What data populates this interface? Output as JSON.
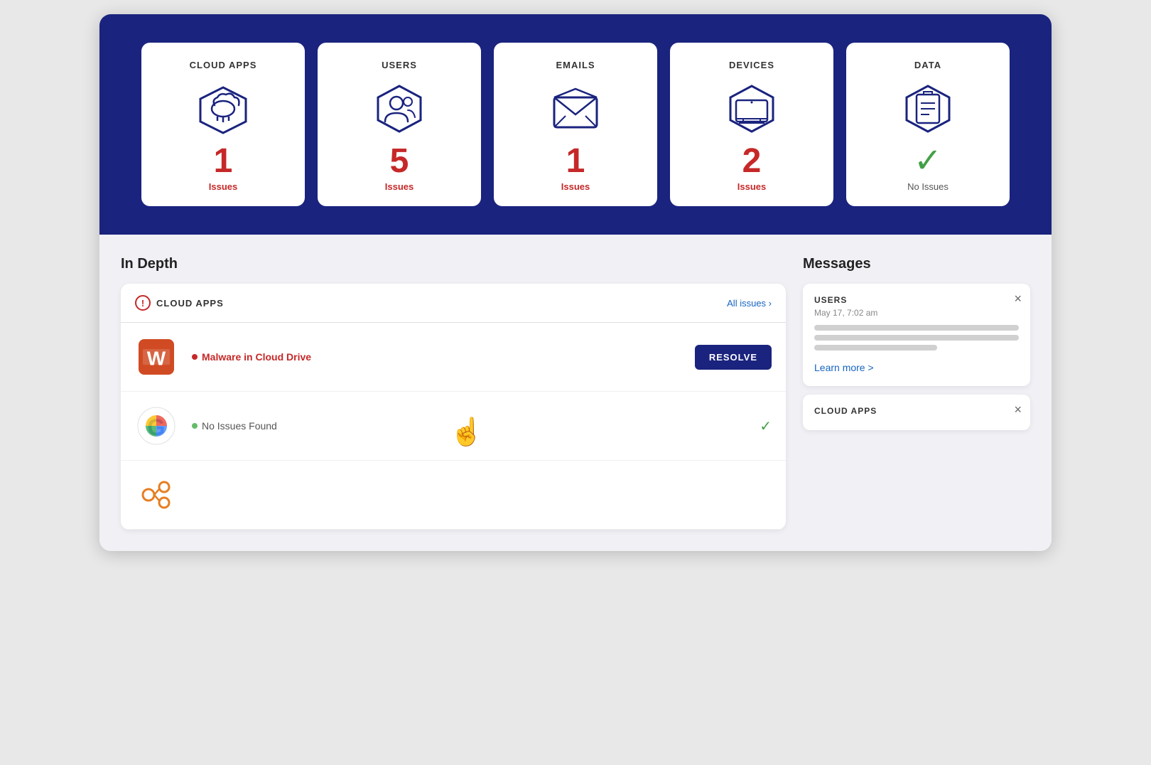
{
  "cards": [
    {
      "id": "cloud-apps",
      "title": "CLOUD APPS",
      "count": "1",
      "label": "Issues",
      "hasIssues": true
    },
    {
      "id": "users",
      "title": "USERS",
      "count": "5",
      "label": "Issues",
      "hasIssues": true
    },
    {
      "id": "emails",
      "title": "EMAILS",
      "count": "1",
      "label": "Issues",
      "hasIssues": true
    },
    {
      "id": "devices",
      "title": "DEVICES",
      "count": "2",
      "label": "Issues",
      "hasIssues": true
    },
    {
      "id": "data",
      "title": "DATA",
      "count": "",
      "label": "No Issues",
      "hasIssues": false
    }
  ],
  "inDepth": {
    "sectionTitle": "In Depth",
    "panelTitle": "CLOUD APPS",
    "allIssuesLink": "All issues ›",
    "apps": [
      {
        "name": "Microsoft Office",
        "issue": "Malware in Cloud Drive",
        "hasIssue": true,
        "resolveLabel": "RESOLVE"
      },
      {
        "name": "Google",
        "issue": "No Issues Found",
        "hasIssue": false,
        "resolveLabel": ""
      },
      {
        "name": "Other App",
        "issue": "",
        "hasIssue": false,
        "resolveLabel": ""
      }
    ]
  },
  "messages": {
    "sectionTitle": "Messages",
    "cards": [
      {
        "title": "USERS",
        "time": "May 17, 7:02 am",
        "learnMore": "Learn more >",
        "lines": [
          100,
          100,
          60
        ]
      },
      {
        "title": "CLOUD APPS",
        "time": "",
        "learnMore": "",
        "lines": []
      }
    ]
  }
}
